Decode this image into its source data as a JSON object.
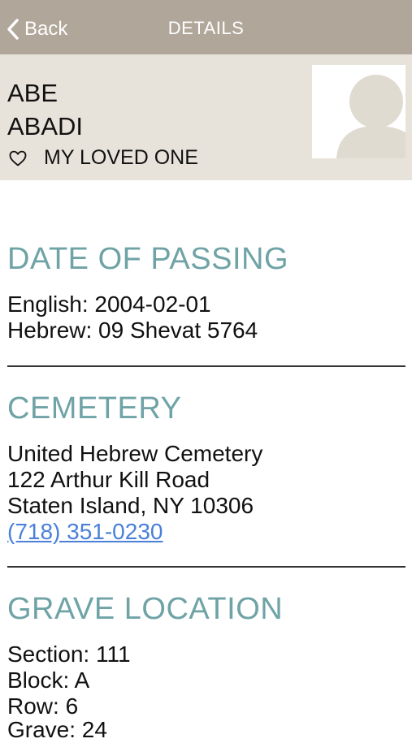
{
  "navbar": {
    "back_label": "Back",
    "title": "DETAILS",
    "icons": {
      "back": "chevron-left-icon"
    }
  },
  "person": {
    "first_name": "ABE",
    "last_name": "ABADI",
    "loved_one_label": "MY LOVED ONE",
    "icons": {
      "loved_one": "heart-outline-icon",
      "photo": "person-placeholder-icon"
    }
  },
  "date_of_passing": {
    "title": "DATE OF PASSING",
    "english": "English: 2004-02-01",
    "hebrew": "Hebrew: 09 Shevat 5764"
  },
  "cemetery": {
    "title": "CEMETERY",
    "name": "United Hebrew Cemetery",
    "address_line1": "122 Arthur Kill Road",
    "address_line2": "Staten Island, NY 10306",
    "phone": "(718) 351-0230"
  },
  "grave_location": {
    "title": "GRAVE LOCATION",
    "section": "Section: 111",
    "block": "Block: A",
    "row": "Row: 6",
    "grave": "Grave: 24"
  },
  "colors": {
    "navbar": "#b0a699",
    "header": "#e8e3da",
    "section_title": "#6fa3a6",
    "link": "#4a80d8"
  }
}
